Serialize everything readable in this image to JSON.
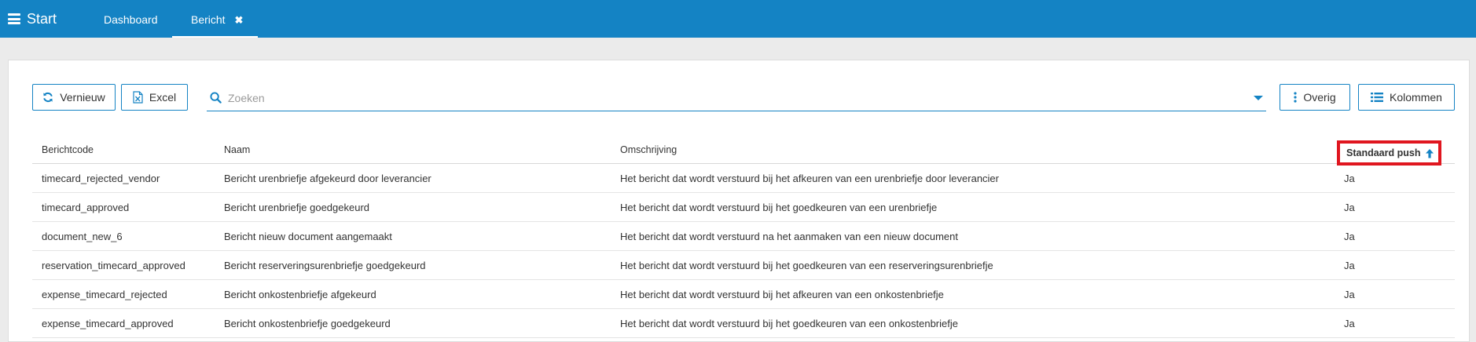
{
  "topbar": {
    "start_label": "Start",
    "tabs": [
      {
        "label": "Dashboard"
      },
      {
        "label": "Bericht",
        "close_glyph": "✖"
      }
    ]
  },
  "toolbar": {
    "refresh_label": "Vernieuw",
    "excel_label": "Excel",
    "search_placeholder": "Zoeken",
    "search_value": "",
    "more_label": "Overig",
    "columns_label": "Kolommen"
  },
  "table": {
    "columns": [
      "Berichtcode",
      "Naam",
      "Omschrijving",
      "Standaard push"
    ],
    "sort": {
      "column": "Standaard push",
      "direction": "asc",
      "icon": "arrow-up-icon"
    },
    "rows": [
      [
        "timecard_rejected_vendor",
        "Bericht urenbriefje afgekeurd door leverancier",
        "Het bericht dat wordt verstuurd bij het afkeuren van een urenbriefje door leverancier",
        "Ja"
      ],
      [
        "timecard_approved",
        "Bericht urenbriefje goedgekeurd",
        "Het bericht dat wordt verstuurd bij het goedkeuren van een urenbriefje",
        "Ja"
      ],
      [
        "document_new_6",
        "Bericht nieuw document aangemaakt",
        "Het bericht dat wordt verstuurd na het aanmaken van een nieuw document",
        "Ja"
      ],
      [
        "reservation_timecard_approved",
        "Bericht reserveringsurenbriefje goedgekeurd",
        "Het bericht dat wordt verstuurd bij het goedkeuren van een reserveringsurenbriefje",
        "Ja"
      ],
      [
        "expense_timecard_rejected",
        "Bericht onkostenbriefje afgekeurd",
        "Het bericht dat wordt verstuurd bij het afkeuren van een onkostenbriefje",
        "Ja"
      ],
      [
        "expense_timecard_approved",
        "Bericht onkostenbriefje goedgekeurd",
        "Het bericht dat wordt verstuurd bij het goedkeuren van een onkostenbriefje",
        "Ja"
      ]
    ]
  },
  "colors": {
    "accent": "#1483c4",
    "highlight": "#e0161f",
    "background": "#ebebeb"
  }
}
